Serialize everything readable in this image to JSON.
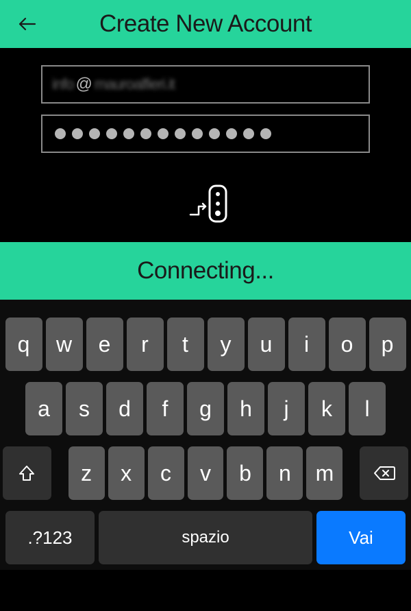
{
  "header": {
    "title": "Create New Account"
  },
  "form": {
    "email_prefix": "info",
    "email_at": "@",
    "email_domain": "mauroalfieri.it",
    "password_length": 13
  },
  "status": {
    "text": "Connecting..."
  },
  "keyboard": {
    "row1": [
      "q",
      "w",
      "e",
      "r",
      "t",
      "y",
      "u",
      "i",
      "o",
      "p"
    ],
    "row2": [
      "a",
      "s",
      "d",
      "f",
      "g",
      "h",
      "j",
      "k",
      "l"
    ],
    "row3": [
      "z",
      "x",
      "c",
      "v",
      "b",
      "n",
      "m"
    ],
    "symbols_label": ".?123",
    "space_label": "spazio",
    "go_label": "Vai"
  }
}
